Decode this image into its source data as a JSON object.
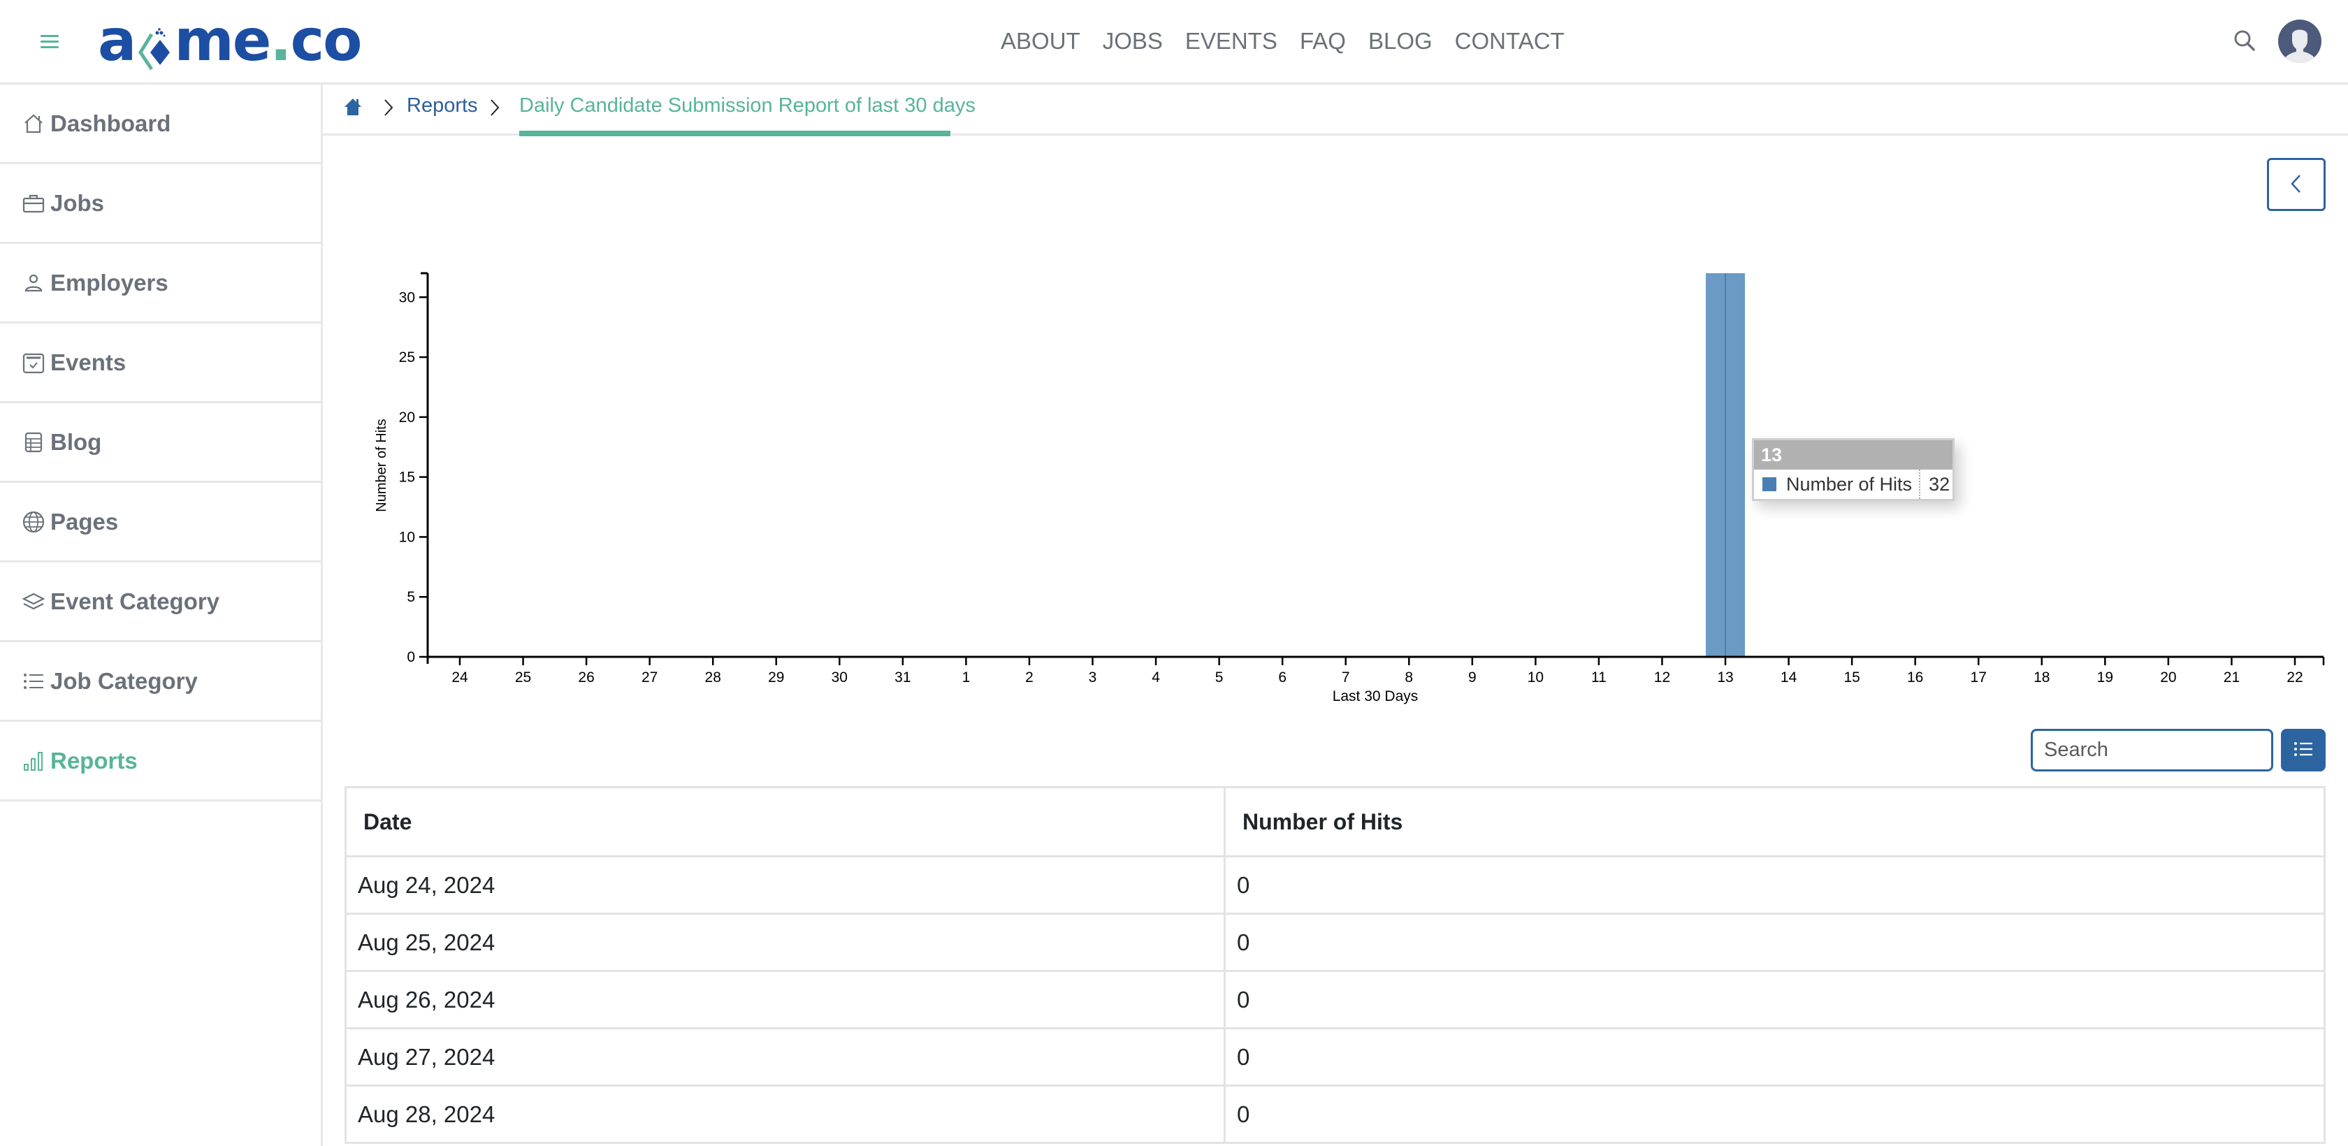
{
  "header": {
    "logo_text_left": "a",
    "logo_text_right": "me",
    "logo_dot": ".",
    "logo_tld": "co",
    "nav": [
      "ABOUT",
      "JOBS",
      "EVENTS",
      "FAQ",
      "BLOG",
      "CONTACT"
    ]
  },
  "sidebar": {
    "items": [
      {
        "label": "Dashboard",
        "icon": "house-icon",
        "active": false
      },
      {
        "label": "Jobs",
        "icon": "briefcase-icon",
        "active": false
      },
      {
        "label": "Employers",
        "icon": "person-icon",
        "active": false
      },
      {
        "label": "Events",
        "icon": "calendar-check-icon",
        "active": false
      },
      {
        "label": "Blog",
        "icon": "table-doc-icon",
        "active": false
      },
      {
        "label": "Pages",
        "icon": "globe-icon",
        "active": false
      },
      {
        "label": "Event Category",
        "icon": "layers-icon",
        "active": false
      },
      {
        "label": "Job Category",
        "icon": "list-icon",
        "active": false
      },
      {
        "label": "Reports",
        "icon": "bar-chart-icon",
        "active": true
      }
    ]
  },
  "breadcrumb": {
    "home_icon": "home-icon",
    "link": "Reports",
    "current": "Daily Candidate Submission Report of last 30 days"
  },
  "colors": {
    "brand_blue": "#1c4ea3",
    "accent_green": "#58b49a",
    "link_blue": "#2c64a0",
    "bar": "#6b9ac4",
    "text_muted": "#6b717a"
  },
  "tooltip": {
    "title": "13",
    "series": "Number of Hits",
    "value": "32"
  },
  "table": {
    "search_placeholder": "Search",
    "columns": [
      "Date",
      "Number of Hits"
    ],
    "rows": [
      [
        "Aug 24, 2024",
        "0"
      ],
      [
        "Aug 25, 2024",
        "0"
      ],
      [
        "Aug 26, 2024",
        "0"
      ],
      [
        "Aug 27, 2024",
        "0"
      ],
      [
        "Aug 28, 2024",
        "0"
      ]
    ]
  },
  "chart_data": {
    "type": "bar",
    "title": "",
    "xlabel": "Last 30 Days",
    "ylabel": "Number of Hits",
    "ylim": [
      0,
      32
    ],
    "yticks": [
      0,
      5,
      10,
      15,
      20,
      25,
      30
    ],
    "grid": false,
    "categories": [
      "24",
      "25",
      "26",
      "27",
      "28",
      "29",
      "30",
      "31",
      "1",
      "2",
      "3",
      "4",
      "5",
      "6",
      "7",
      "8",
      "9",
      "10",
      "11",
      "12",
      "13",
      "14",
      "15",
      "16",
      "17",
      "18",
      "19",
      "20",
      "21",
      "22"
    ],
    "series": [
      {
        "name": "Number of Hits",
        "values": [
          0,
          0,
          0,
          0,
          0,
          0,
          0,
          0,
          0,
          0,
          0,
          0,
          0,
          0,
          0,
          0,
          0,
          0,
          0,
          0,
          32,
          0,
          0,
          0,
          0,
          0,
          0,
          0,
          0,
          0
        ]
      }
    ],
    "highlighted_category": "13"
  }
}
